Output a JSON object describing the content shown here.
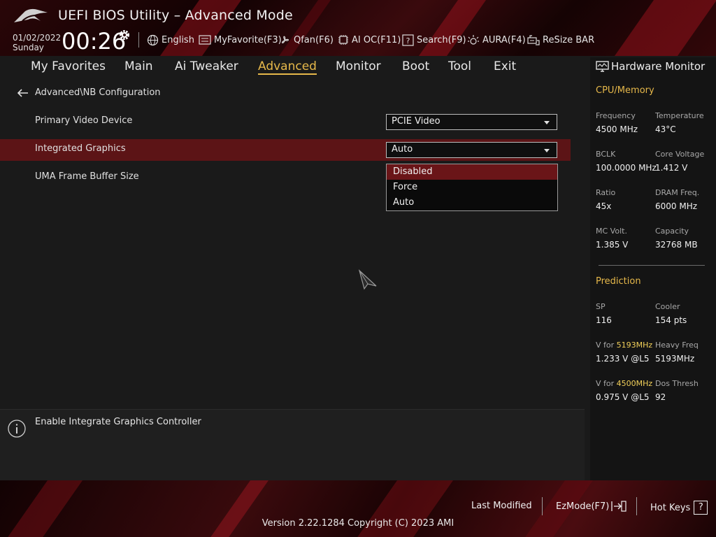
{
  "header": {
    "title": "UEFI BIOS Utility – Advanced Mode",
    "date": "01/02/2022",
    "day": "Sunday",
    "time": "00:26",
    "tools": [
      {
        "label": "English",
        "icon": "globe-icon"
      },
      {
        "label": "MyFavorite(F3)",
        "icon": "favorite-icon"
      },
      {
        "label": "Qfan(F6)",
        "icon": "fan-icon"
      },
      {
        "label": "AI OC(F11)",
        "icon": "ai-chip-icon"
      },
      {
        "label": "Search(F9)",
        "icon": "search-help-icon"
      },
      {
        "label": "AURA(F4)",
        "icon": "aura-icon"
      },
      {
        "label": "ReSize BAR",
        "icon": "resize-bar-icon"
      }
    ]
  },
  "nav": {
    "tabs": [
      "My Favorites",
      "Main",
      "Ai Tweaker",
      "Advanced",
      "Monitor",
      "Boot",
      "Tool",
      "Exit"
    ],
    "active": "Advanced"
  },
  "main": {
    "breadcrumb": "Advanced\\NB Configuration",
    "rows": [
      {
        "label": "Primary Video Device",
        "value": "PCIE Video"
      },
      {
        "label": "Integrated Graphics",
        "value": "Auto"
      },
      {
        "label": "UMA Frame Buffer Size"
      }
    ],
    "dropdown": {
      "options": [
        "Disabled",
        "Force",
        "Auto"
      ],
      "highlighted": "Disabled"
    }
  },
  "help": {
    "text": "Enable Integrate Graphics Controller"
  },
  "hw_monitor": {
    "title": "Hardware Monitor",
    "cpu_memory": {
      "heading": "CPU/Memory",
      "items": [
        {
          "label": "Frequency",
          "value": "4500 MHz"
        },
        {
          "label": "Temperature",
          "value": "43°C"
        },
        {
          "label": "BCLK",
          "value": "100.0000 MHz"
        },
        {
          "label": "Core Voltage",
          "value": "1.412 V"
        },
        {
          "label": "Ratio",
          "value": "45x"
        },
        {
          "label": "DRAM Freq.",
          "value": "6000 MHz"
        },
        {
          "label": "MC Volt.",
          "value": "1.385 V"
        },
        {
          "label": "Capacity",
          "value": "32768 MB"
        }
      ]
    },
    "prediction": {
      "heading": "Prediction",
      "sp_label": "SP",
      "sp_value": "116",
      "cooler_label": "Cooler",
      "cooler_value": "154 pts",
      "v1_label_prefix": "V for ",
      "v1_freq": "5193MHz",
      "v1_value": "1.233 V @L5",
      "heavy_label": "Heavy Freq",
      "heavy_value": "5193MHz",
      "v2_label_prefix": "V for ",
      "v2_freq": "4500MHz",
      "v2_value": "0.975 V @L5",
      "dos_label": "Dos Thresh",
      "dos_value": "92"
    }
  },
  "footer": {
    "last_modified": "Last Modified",
    "ezmode": "EzMode(F7)",
    "hotkeys": "Hot Keys",
    "hotkeys_key": "?",
    "version": "Version 2.22.1284 Copyright (C) 2023 AMI"
  },
  "colors": {
    "accent": "#e6b84a",
    "highlight_row": "#5c1416",
    "selected_option": "#6a1518",
    "prediction_value": "#f2d05a"
  }
}
